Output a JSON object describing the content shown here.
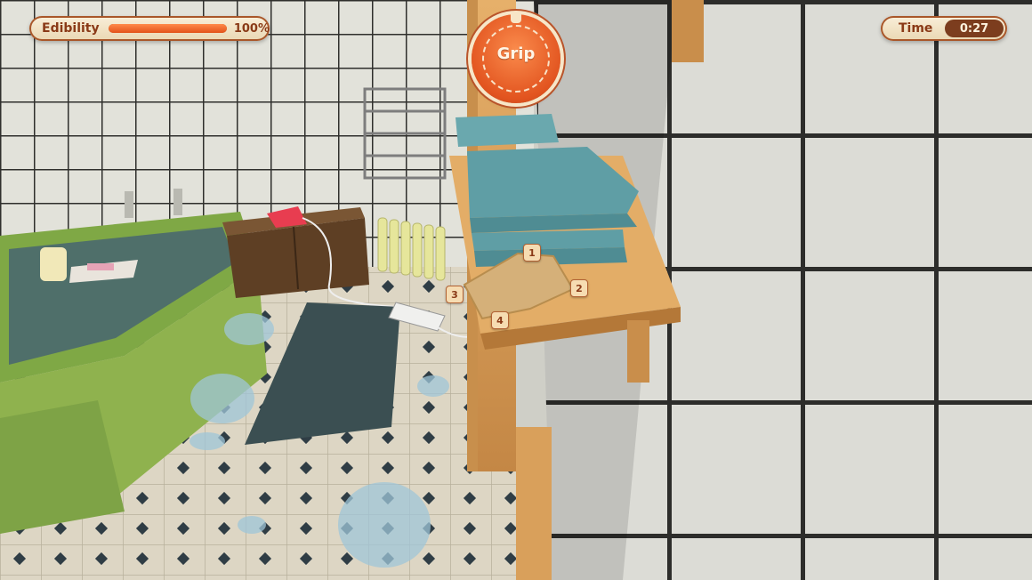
{
  "hud": {
    "edibility": {
      "label": "Edibility",
      "value_text": "100%",
      "fraction": 1.0
    },
    "timer": {
      "label": "Time",
      "value": "0:27"
    },
    "grip": {
      "label": "Grip"
    }
  },
  "toast_markers": [
    "1",
    "2",
    "3",
    "4"
  ],
  "colors": {
    "accent": "#e3521a",
    "hud_text": "#8a3a17",
    "hud_bg": "#f3e4c6",
    "bathtub": "#8fb24e",
    "towels": "#5f9ea5",
    "shelf_wood": "#d9a05b",
    "bathmat": "#3b4f52"
  }
}
